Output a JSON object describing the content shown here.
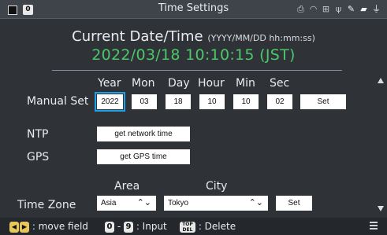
{
  "status_bar": {
    "badge": "0",
    "title": "Time Settings",
    "icons": [
      "printer-icon",
      "wifi-icon",
      "network-icon",
      "usb-icon",
      "wrench-icon",
      "sd-card-icon",
      "power-plug-icon"
    ]
  },
  "current": {
    "label": "Current Date/Time",
    "format": "(YYYY/MM/DD hh:mm:ss)",
    "value": "2022/03/18 10:10:15 (JST)"
  },
  "manual": {
    "headers": {
      "year": "Year",
      "mon": "Mon",
      "day": "Day",
      "hour": "Hour",
      "min": "Min",
      "sec": "Sec"
    },
    "label": "Manual Set",
    "values": {
      "year": "2022",
      "mon": "03",
      "day": "18",
      "hour": "10",
      "min": "10",
      "sec": "02"
    },
    "set_label": "Set"
  },
  "ntp": {
    "label": "NTP",
    "button": "get network time"
  },
  "gps": {
    "label": "GPS",
    "button": "get GPS time"
  },
  "timezone": {
    "area_header": "Area",
    "city_header": "City",
    "label": "Time Zone",
    "area": "Asia",
    "city": "Tokyo",
    "set_label": "Set"
  },
  "footer": {
    "move_field": ": move field",
    "key_0": "0",
    "key_9": "9",
    "input": ": Input",
    "key_top": "TOP",
    "key_del": "DEL",
    "delete": ": Delete"
  },
  "colors": {
    "accent": "#4cc76a",
    "focus": "#1ea0e8",
    "background": "#2f3338"
  }
}
